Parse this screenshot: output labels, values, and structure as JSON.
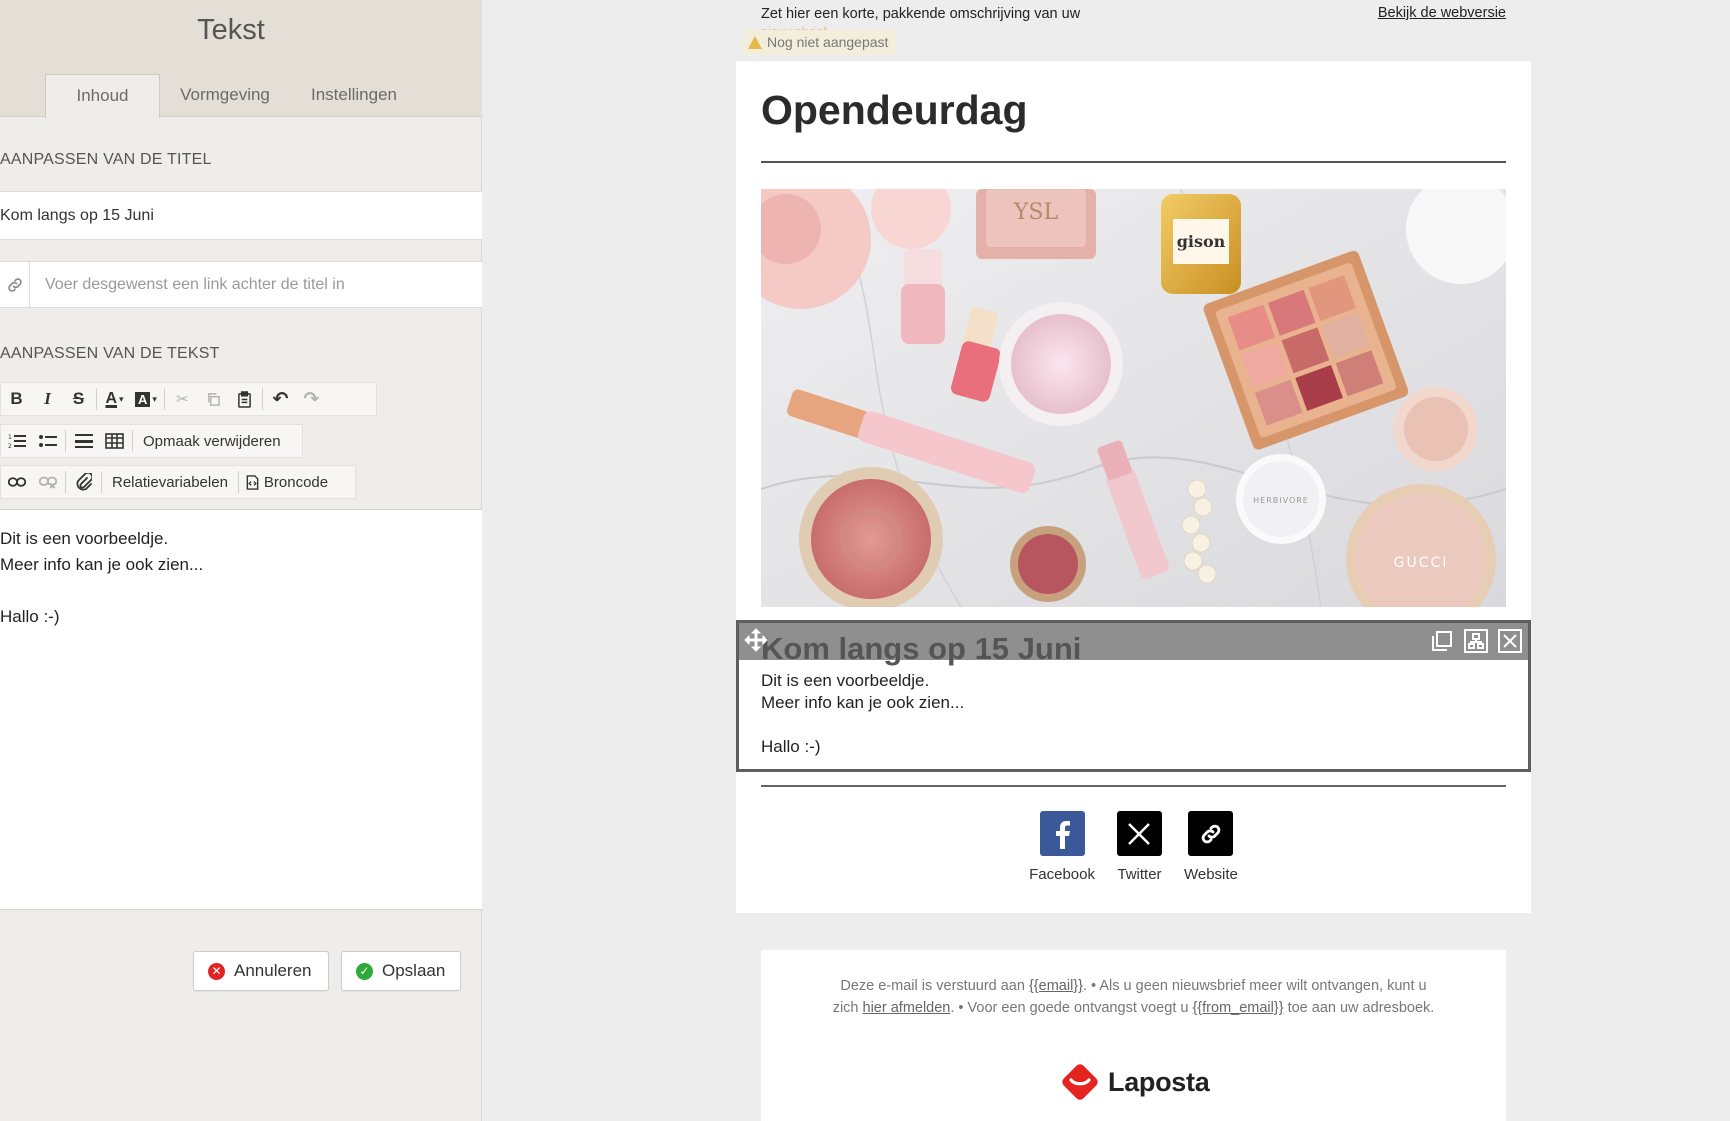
{
  "panel": {
    "title": "Tekst",
    "tabs": [
      "Inhoud",
      "Vormgeving",
      "Instellingen"
    ],
    "title_section_label": "AANPASSEN VAN DE TITEL",
    "title_value": "Kom langs op 15 Juni",
    "link_placeholder": "Voer desgewenst een link achter de titel in",
    "text_section_label": "AANPASSEN VAN DE TEKST",
    "toolbar": {
      "remove_format": "Opmaak verwijderen",
      "relation_variables": "Relatievariabelen",
      "source": "Broncode"
    },
    "editor_lines": [
      "Dit is een voorbeeldje.",
      "Meer info kan je ook zien...",
      "",
      "Hallo :-)"
    ],
    "cancel_label": "Annuleren",
    "save_label": "Opslaan"
  },
  "preview": {
    "preheader": "Zet hier een korte, pakkende omschrijving van uw",
    "preheader_ghost": "nieuwsbrief",
    "not_changed": "Nog niet aangepast",
    "webversion": "Bekijk de webversie",
    "mail_title": "Opendeurdag",
    "block_title": "Kom langs op 15 Juni",
    "block_lines": [
      "Dit is een voorbeeldje.",
      "Meer info kan je ook zien...",
      "",
      "Hallo :-)"
    ],
    "social": [
      {
        "label": "Facebook",
        "icon": "facebook-icon",
        "color": "#3b5998"
      },
      {
        "label": "Twitter",
        "icon": "x-icon",
        "color": "#000000"
      },
      {
        "label": "Website",
        "icon": "link-icon",
        "color": "#000000"
      }
    ],
    "footer": {
      "part1": "Deze e-mail is verstuurd aan ",
      "email_var": "{{email}}",
      "part2": ". • Als u geen nieuwsbrief meer wilt ontvangen, kunt u zich ",
      "unsubscribe": "hier afmelden",
      "part3": ". • Voor een goede ontvangst voegt u ",
      "from_var": "{{from_email}}",
      "part4": " toe aan uw adresboek.",
      "logo_text": "Laposta"
    }
  },
  "colors": {
    "danger": "#e02424",
    "success": "#2eaa3a",
    "brand_red": "#e52421"
  }
}
